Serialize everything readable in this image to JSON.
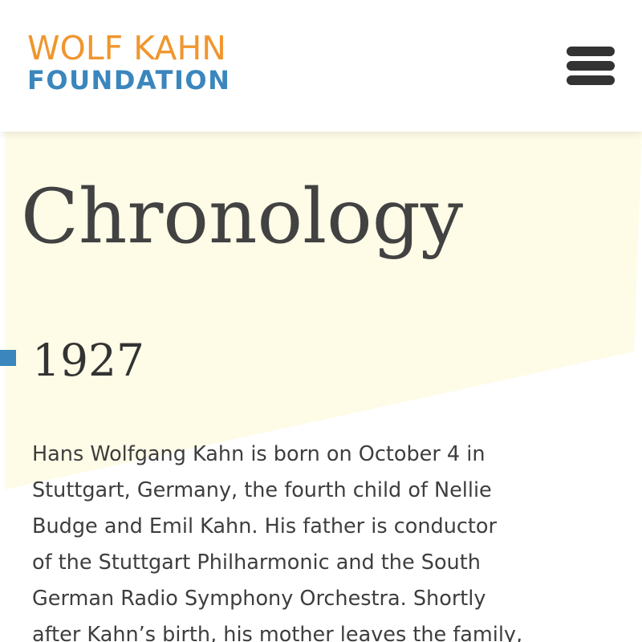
{
  "header": {
    "logo": {
      "line1": "WOLF KAHN",
      "line2": "FOUNDATION",
      "line1_color": "#f0962e",
      "line2_color": "#3a86bd"
    },
    "menu": {
      "icon": "hamburger-menu-icon",
      "color": "#333333"
    }
  },
  "hero": {
    "background_color": "#fefbe7",
    "title": "Chronology"
  },
  "timeline": {
    "marker_color": "#3a86bd",
    "entries": [
      {
        "year": "1927",
        "text_lines": [
          "Hans Wolfgang Kahn is born on October 4 in",
          "Stuttgart, Germany, the fourth child of Nellie",
          "Budge and Emil Kahn. His father is conductor",
          "of the Stuttgart Philharmonic and the South",
          "German Radio Symphony Orchestra. Shortly",
          "after Kahn’s birth, his mother leaves the family,"
        ]
      }
    ]
  }
}
